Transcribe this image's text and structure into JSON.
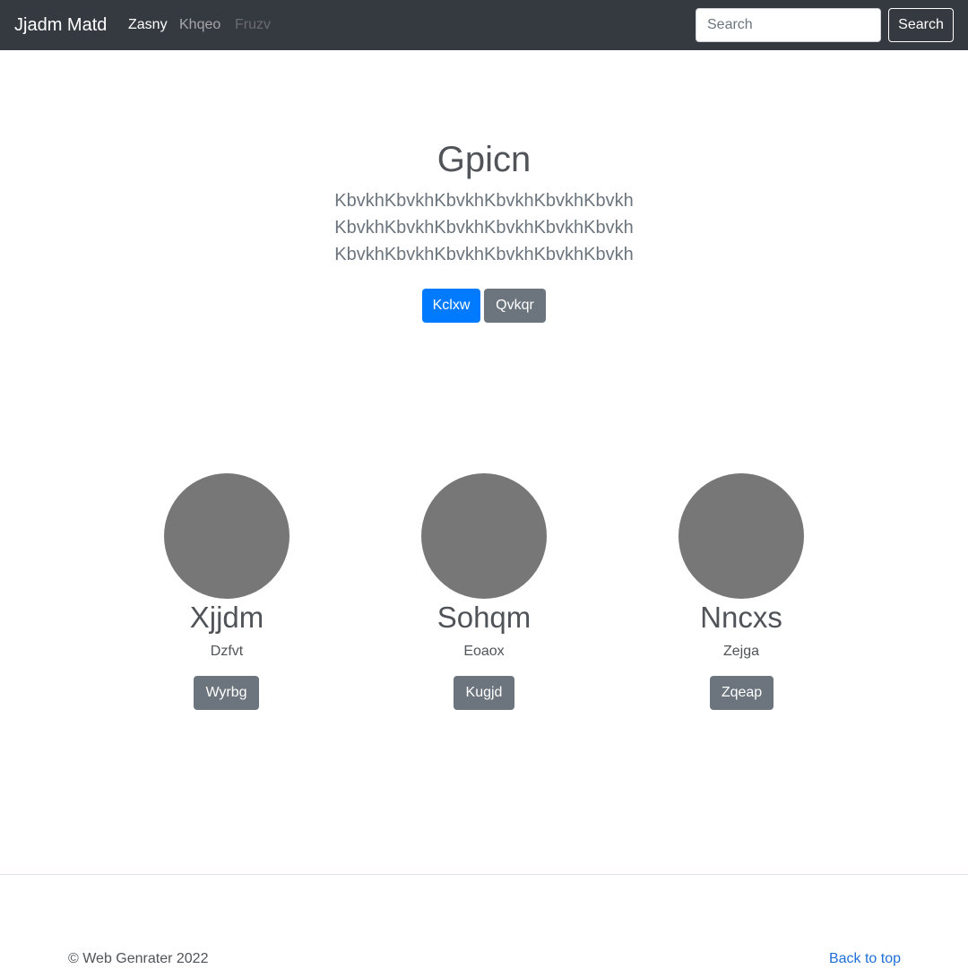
{
  "navbar": {
    "brand": "Jjadm Matd",
    "links": [
      {
        "label": "Zasny",
        "state": "active"
      },
      {
        "label": "Khqeo",
        "state": "normal"
      },
      {
        "label": "Fruzv",
        "state": "disabled"
      }
    ],
    "search_placeholder": "Search",
    "search_button": "Search"
  },
  "hero": {
    "title": "Gpicn",
    "lines": [
      "KbvkhKbvkhKbvkhKbvkhKbvkhKbvkh",
      "KbvkhKbvkhKbvkhKbvkhKbvkhKbvkh",
      "KbvkhKbvkhKbvkhKbvkhKbvkhKbvkh"
    ],
    "primary_button": "Kclxw",
    "secondary_button": "Qvkqr"
  },
  "cards": [
    {
      "name": "Xjjdm",
      "subtitle": "Dzfvt",
      "button": "Wyrbg"
    },
    {
      "name": "Sohqm",
      "subtitle": "Eoaox",
      "button": "Kugjd"
    },
    {
      "name": "Nncxs",
      "subtitle": "Zejga",
      "button": "Zqeap"
    }
  ],
  "footer": {
    "copyright": "© Web Genrater 2022",
    "back_to_top": "Back to top"
  },
  "colors": {
    "navbar_bg": "#343a40",
    "primary": "#007bff",
    "secondary": "#6c757d",
    "placeholder_circle": "#777777",
    "link": "#1e6fd9"
  }
}
